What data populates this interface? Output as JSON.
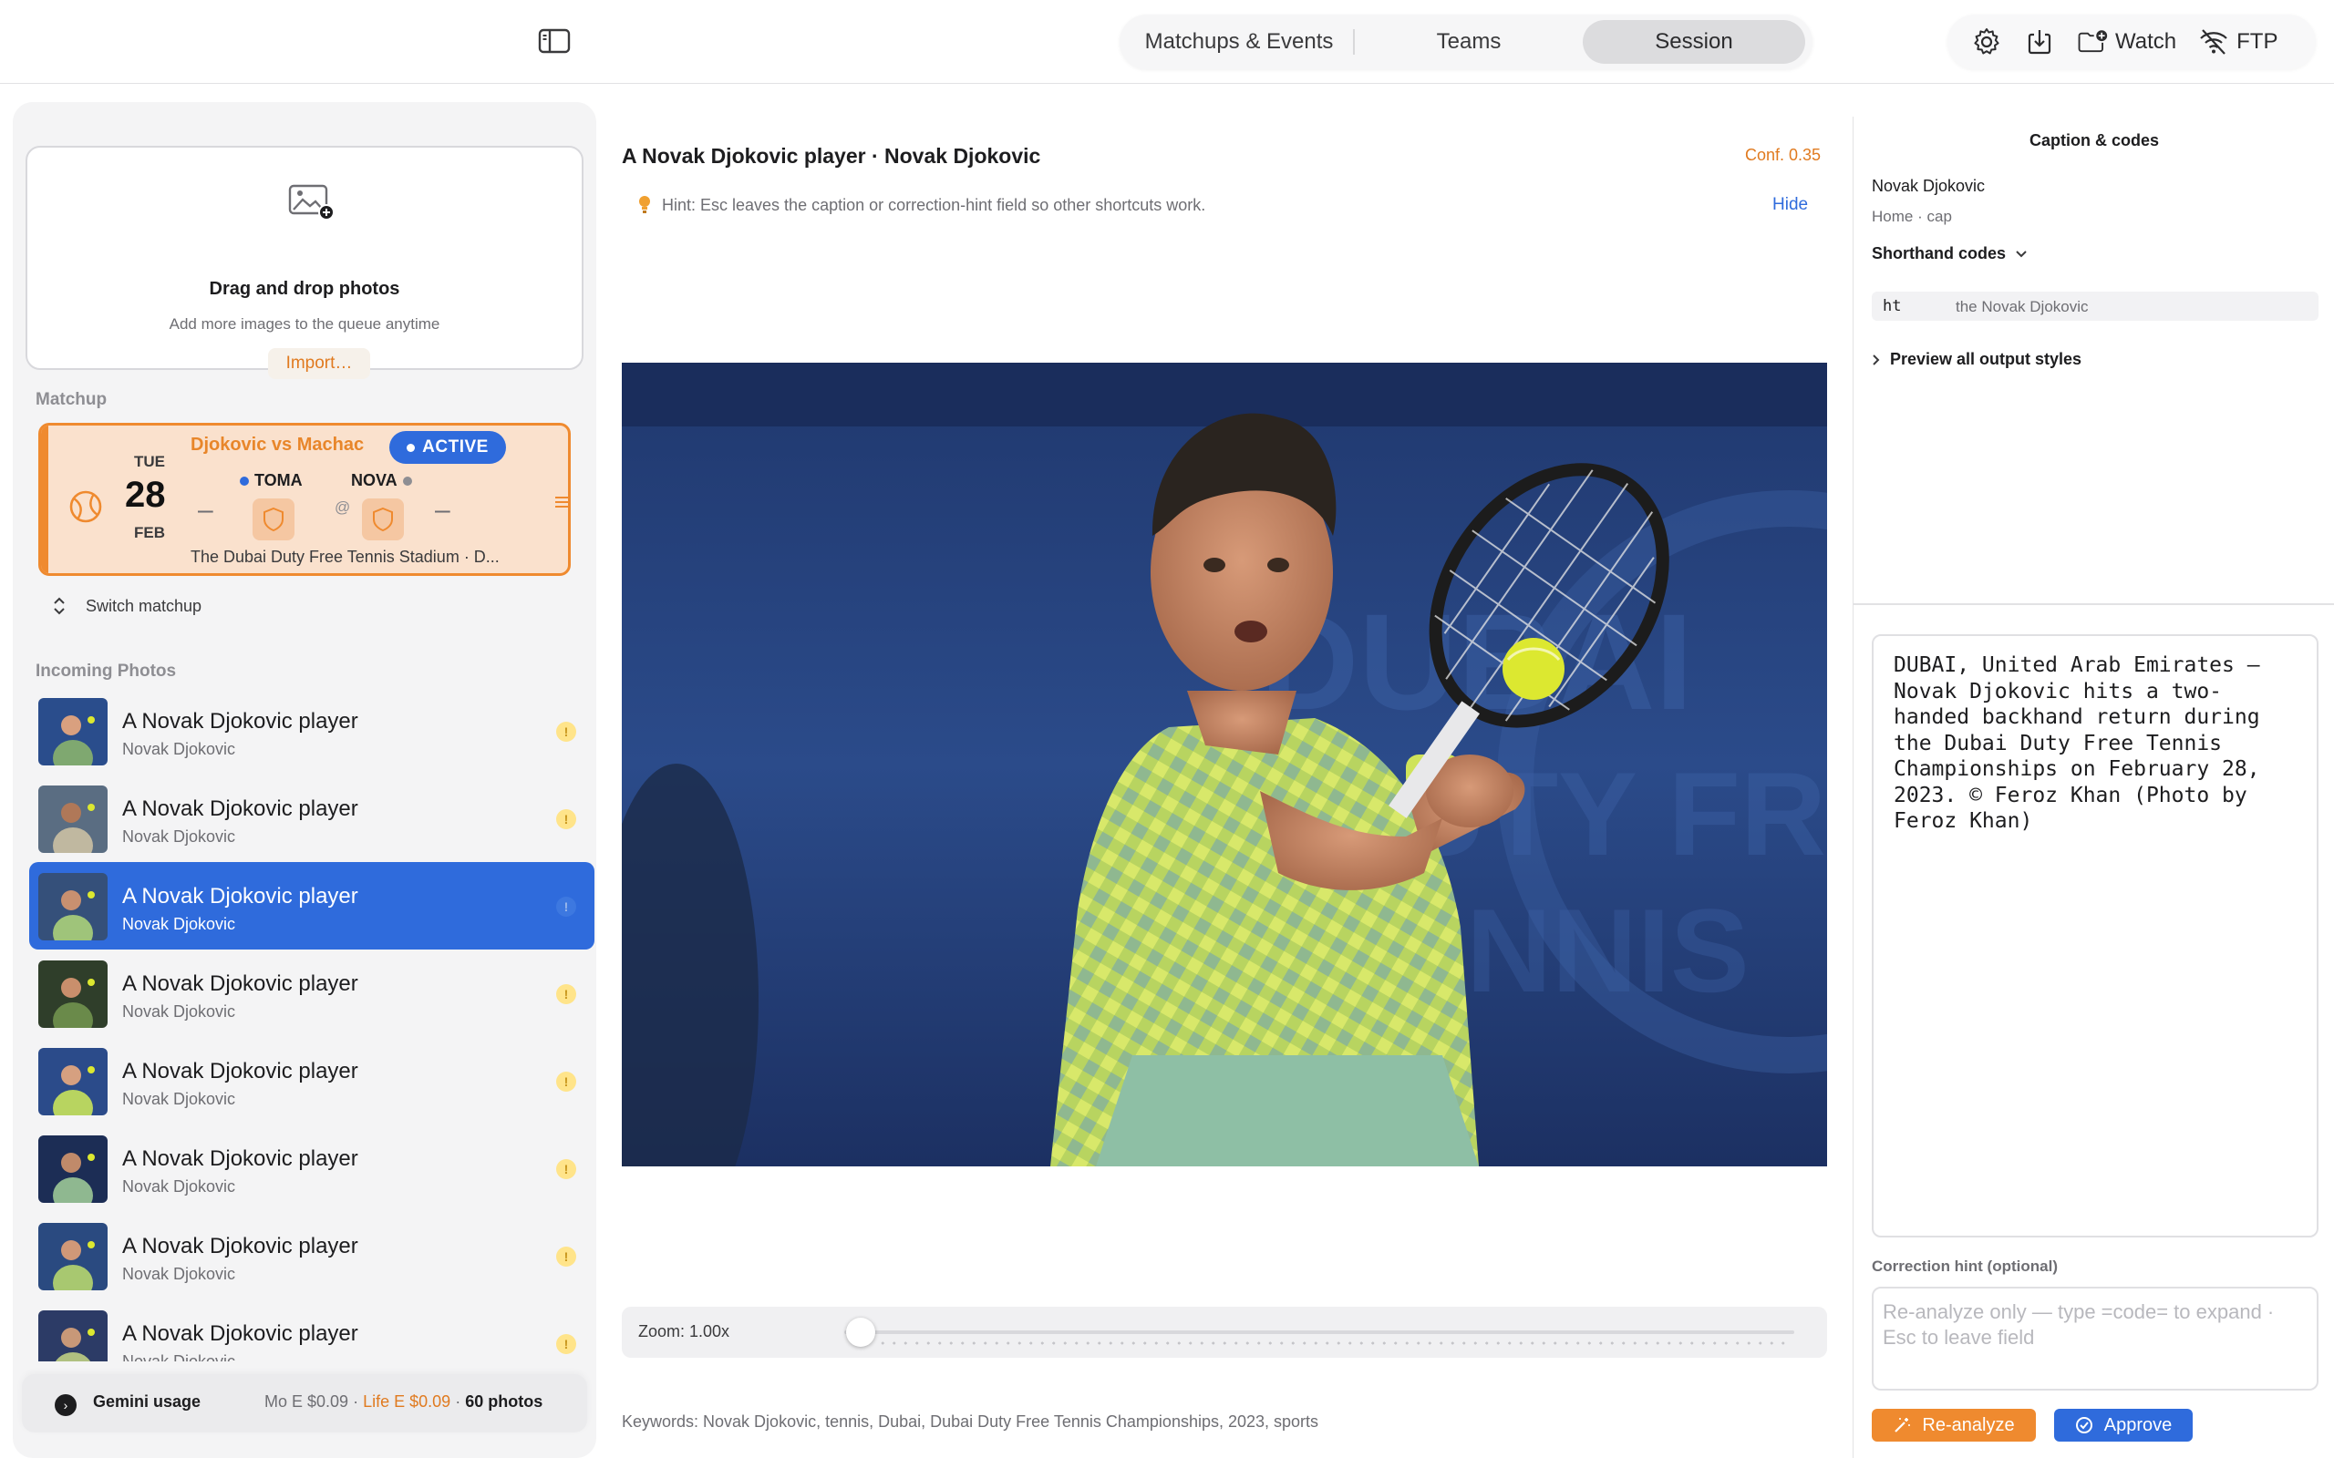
{
  "toolbar": {
    "tabs": [
      {
        "label": "Matchups & Events"
      },
      {
        "label": "Teams"
      },
      {
        "label": "Session",
        "selected": true
      }
    ],
    "watch_label": "Watch",
    "ftp_label": "FTP",
    "icons": [
      "sidebar-toggle-icon",
      "gear-icon",
      "download-icon",
      "folder-add-icon",
      "wifi-off-icon"
    ]
  },
  "sidebar": {
    "dropzone": {
      "title": "Drag and drop photos",
      "subtitle": "Add more images to the queue anytime",
      "import_label": "Import…"
    },
    "matchup_section_label": "Matchup",
    "matchup": {
      "dow": "TUE",
      "day": "28",
      "month": "FEB",
      "title": "Djokovic vs Machac",
      "badge": "ACTIVE",
      "home_code": "TOMA",
      "away_code": "NOVA",
      "home_score": "–",
      "away_score": "–",
      "at": "@",
      "venue": "The Dubai Duty Free Tennis Stadium · D...",
      "accent": "#ef8a2f"
    },
    "switch_label": "Switch matchup",
    "incoming_label": "Incoming Photos",
    "photos": [
      {
        "title": "A Novak Djokovic player",
        "subtitle": "Novak Djokovic",
        "status": "!"
      },
      {
        "title": "A Novak Djokovic player",
        "subtitle": "Novak Djokovic",
        "status": "!"
      },
      {
        "title": "A Novak Djokovic player",
        "subtitle": "Novak Djokovic",
        "status": "!",
        "selected": true
      },
      {
        "title": "A Novak Djokovic player",
        "subtitle": "Novak Djokovic",
        "status": "!"
      },
      {
        "title": "A Novak Djokovic player",
        "subtitle": "Novak Djokovic",
        "status": "!"
      },
      {
        "title": "A Novak Djokovic player",
        "subtitle": "Novak Djokovic",
        "status": "!"
      },
      {
        "title": "A Novak Djokovic player",
        "subtitle": "Novak Djokovic",
        "status": "!"
      },
      {
        "title": "A Novak Djokovic player",
        "subtitle": "Novak Djokovic",
        "status": "!"
      }
    ],
    "usage": {
      "label": "Gemini usage",
      "month": "Mo E $0.09",
      "sep1": "·",
      "life": "Life E $0.09",
      "sep2": "·",
      "count": "60 photos"
    }
  },
  "center": {
    "title": "A Novak Djokovic player · Novak Djokovic",
    "confidence": "Conf. 0.35",
    "hint": "Hint: Esc leaves the caption or correction-hint field so other shortcuts work.",
    "hide_label": "Hide",
    "zoom_label": "Zoom: 1.00x",
    "zoom_value": 1.0,
    "keywords": "Keywords: Novak Djokovic, tennis, Dubai, Dubai Duty Free Tennis Championships, 2023, sports"
  },
  "right": {
    "header": "Caption & codes",
    "name": "Novak Djokovic",
    "crumb_home": "Home",
    "crumb_sep": "·",
    "crumb_cap": "cap",
    "shorthand_label": "Shorthand codes",
    "codes": [
      {
        "key": "ht",
        "value": "the Novak Djokovic"
      }
    ],
    "preview_label": "Preview all output styles",
    "caption": "DUBAI, United Arab Emirates — Novak Djokovic hits a two-handed backhand return during the Dubai Duty Free Tennis Championships on February 28, 2023. © Feroz Khan (Photo by Feroz Khan)",
    "correction_label": "Correction hint (optional)",
    "correction_placeholder": "Re-analyze only — type =code= to expand · Esc to leave field",
    "reanalyze_label": "Re-analyze",
    "approve_label": "Approve"
  }
}
